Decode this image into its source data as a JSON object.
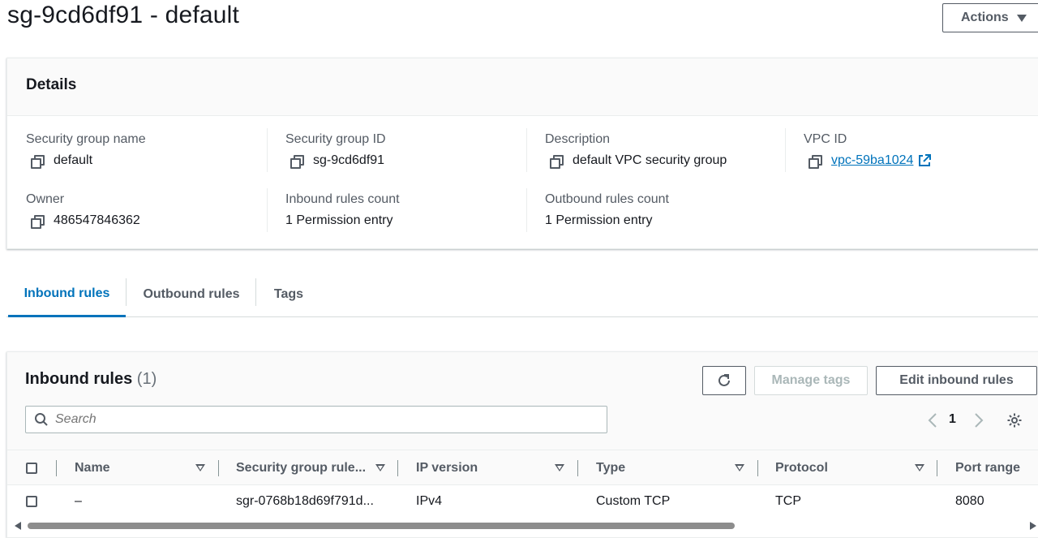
{
  "page": {
    "title": "sg-9cd6df91 - default"
  },
  "actions": {
    "label": "Actions"
  },
  "details": {
    "title": "Details",
    "security_group_name": {
      "label": "Security group name",
      "value": "default"
    },
    "security_group_id": {
      "label": "Security group ID",
      "value": "sg-9cd6df91"
    },
    "description": {
      "label": "Description",
      "value": "default VPC security group"
    },
    "vpc_id": {
      "label": "VPC ID",
      "value": "vpc-59ba1024"
    },
    "owner": {
      "label": "Owner",
      "value": "486547846362"
    },
    "inbound_rules_count": {
      "label": "Inbound rules count",
      "value": "1 Permission entry"
    },
    "outbound_rules_count": {
      "label": "Outbound rules count",
      "value": "1 Permission entry"
    }
  },
  "tabs": [
    {
      "label": "Inbound rules",
      "active": true
    },
    {
      "label": "Outbound rules",
      "active": false
    },
    {
      "label": "Tags",
      "active": false
    }
  ],
  "inbound_rules": {
    "title": "Inbound rules",
    "count": "(1)",
    "manage_tags_label": "Manage tags",
    "edit_label": "Edit inbound rules",
    "search_placeholder": "Search",
    "pagination": {
      "current_page": "1"
    },
    "columns": [
      "Name",
      "Security group rule...",
      "IP version",
      "Type",
      "Protocol",
      "Port range"
    ],
    "rows": [
      [
        "–",
        "sgr-0768b18d69f791d...",
        "IPv4",
        "Custom TCP",
        "TCP",
        "8080"
      ]
    ]
  },
  "colors": {
    "accent": "#0073bb",
    "text": "#16191f",
    "muted": "#545b64",
    "disabled": "#aab7b8"
  }
}
